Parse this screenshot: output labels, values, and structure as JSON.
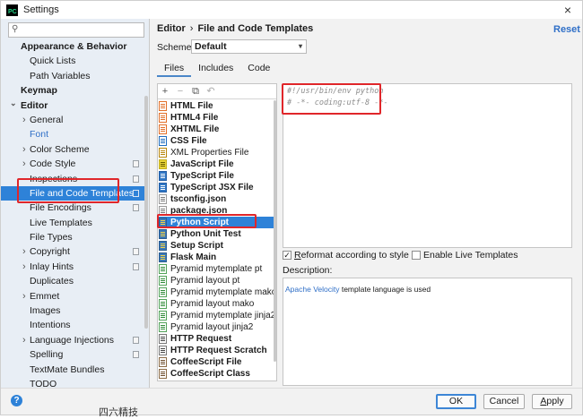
{
  "window": {
    "title": "Settings",
    "close_glyph": "×"
  },
  "search": {
    "placeholder": "",
    "value": ""
  },
  "sidebar": {
    "items": [
      {
        "label": "Appearance & Behavior",
        "bold": true
      },
      {
        "label": "Quick Lists"
      },
      {
        "label": "Path Variables"
      },
      {
        "label": "Keymap",
        "bold": true
      },
      {
        "label": "Editor",
        "bold": true,
        "expanded": true
      },
      {
        "label": "General",
        "collapsed": true
      },
      {
        "label": "Font",
        "color": "#2f6fc7"
      },
      {
        "label": "Color Scheme",
        "collapsed": true
      },
      {
        "label": "Code Style",
        "collapsed": true,
        "copy_icon": true
      },
      {
        "label": "Inspections",
        "copy_icon": true
      },
      {
        "label": "File and Code Templates",
        "selected": true,
        "copy_icon": true
      },
      {
        "label": "File Encodings",
        "copy_icon": true
      },
      {
        "label": "Live Templates"
      },
      {
        "label": "File Types"
      },
      {
        "label": "Copyright",
        "collapsed": true,
        "copy_icon": true
      },
      {
        "label": "Inlay Hints",
        "collapsed": true,
        "copy_icon": true
      },
      {
        "label": "Duplicates"
      },
      {
        "label": "Emmet",
        "collapsed": true
      },
      {
        "label": "Images"
      },
      {
        "label": "Intentions"
      },
      {
        "label": "Language Injections",
        "collapsed": true,
        "copy_icon": true
      },
      {
        "label": "Spelling",
        "copy_icon": true
      },
      {
        "label": "TextMate Bundles"
      },
      {
        "label": "TODO"
      }
    ]
  },
  "header": {
    "breadcrumb_root": "Editor",
    "breadcrumb_sep": "›",
    "breadcrumb_page": "File and Code Templates",
    "reset_label": "Reset"
  },
  "scheme": {
    "label": "Scheme:",
    "value": "Default"
  },
  "tabs": [
    {
      "label": "Files",
      "active": true
    },
    {
      "label": "Includes"
    },
    {
      "label": "Code"
    }
  ],
  "list_toolbar": {
    "add": "+",
    "remove": "−",
    "copy": "⧉",
    "reset": "↶"
  },
  "templates": [
    {
      "label": "HTML File",
      "icon": "html-file-icon",
      "kind": "html",
      "bold": true
    },
    {
      "label": "HTML4 File",
      "icon": "html-file-icon",
      "kind": "html",
      "bold": true
    },
    {
      "label": "XHTML File",
      "icon": "html-file-icon",
      "kind": "html",
      "bold": true
    },
    {
      "label": "CSS File",
      "icon": "css-file-icon",
      "kind": "css",
      "bold": true
    },
    {
      "label": "XML Properties File",
      "icon": "xml-file-icon",
      "kind": "xml",
      "bold": false
    },
    {
      "label": "JavaScript File",
      "icon": "javascript-file-icon",
      "kind": "js",
      "bold": true
    },
    {
      "label": "TypeScript File",
      "icon": "typescript-file-icon",
      "kind": "ts",
      "bold": true
    },
    {
      "label": "TypeScript JSX File",
      "icon": "typescript-file-icon",
      "kind": "ts",
      "bold": true
    },
    {
      "label": "tsconfig.json",
      "icon": "json-file-icon",
      "kind": "json",
      "bold": true
    },
    {
      "label": "package.json",
      "icon": "json-file-icon",
      "kind": "json",
      "bold": true
    },
    {
      "label": "Python Script",
      "icon": "python-file-icon",
      "kind": "py",
      "bold": true,
      "selected": true
    },
    {
      "label": "Python Unit Test",
      "icon": "python-file-icon",
      "kind": "py",
      "bold": true
    },
    {
      "label": "Setup Script",
      "icon": "python-file-icon",
      "kind": "py",
      "bold": true
    },
    {
      "label": "Flask Main",
      "icon": "python-file-icon",
      "kind": "py",
      "bold": true
    },
    {
      "label": "Pyramid mytemplate pt",
      "icon": "pyramid-file-icon",
      "kind": "pyr",
      "bold": false
    },
    {
      "label": "Pyramid layout pt",
      "icon": "pyramid-file-icon",
      "kind": "pyr",
      "bold": false
    },
    {
      "label": "Pyramid mytemplate mako",
      "icon": "pyramid-file-icon",
      "kind": "pyr",
      "bold": false
    },
    {
      "label": "Pyramid layout mako",
      "icon": "pyramid-file-icon",
      "kind": "pyr",
      "bold": false
    },
    {
      "label": "Pyramid mytemplate jinja2",
      "icon": "pyramid-file-icon",
      "kind": "pyr",
      "bold": false
    },
    {
      "label": "Pyramid layout jinja2",
      "icon": "pyramid-file-icon",
      "kind": "pyr",
      "bold": false
    },
    {
      "label": "HTTP Request",
      "icon": "http-file-icon",
      "kind": "http",
      "bold": true
    },
    {
      "label": "HTTP Request Scratch",
      "icon": "http-file-icon",
      "kind": "http",
      "bold": true
    },
    {
      "label": "CoffeeScript File",
      "icon": "coffeescript-file-icon",
      "kind": "coffee",
      "bold": true
    },
    {
      "label": "CoffeeScript Class",
      "icon": "coffeescript-file-icon",
      "kind": "coffee",
      "bold": true
    }
  ],
  "editor": {
    "lines": [
      "#!/usr/bin/env python",
      "# -*- coding:utf-8 -*-"
    ]
  },
  "options": {
    "reformat_label": "Reformat according to style",
    "reformat_checked": true,
    "live_templates_label": "Enable Live Templates",
    "live_templates_checked": false
  },
  "description": {
    "label": "Description:",
    "link_text": "Apache Velocity",
    "rest_text": " template language is used"
  },
  "footer": {
    "help_glyph": "?",
    "ok_label": "OK",
    "cancel_label": "Cancel",
    "apply_label": "Apply"
  },
  "stray_text": "四六精技"
}
